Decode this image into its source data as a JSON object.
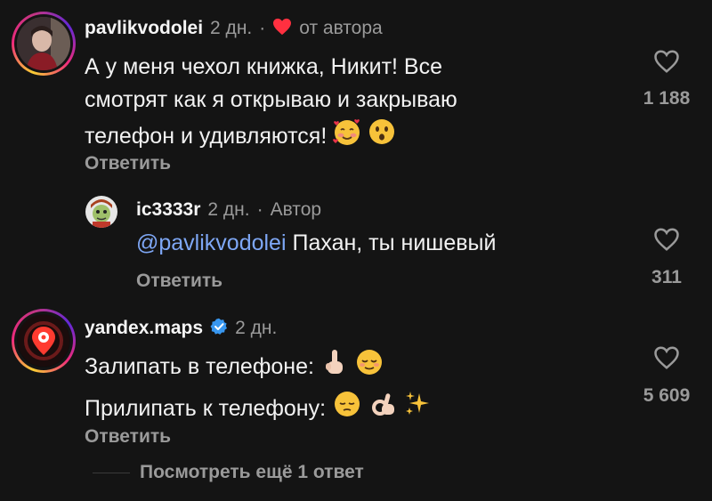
{
  "comments": [
    {
      "username": "pavlikvodolei",
      "time": "2 дн.",
      "separator": "·",
      "liked_by_author_label": "от автора",
      "text_lines": [
        "А у меня чехол книжка, Никит! Все",
        "смотрят как я открываю и закрываю",
        "телефон и удивляются!"
      ],
      "emojis": [
        "smiling-face-with-hearts-icon",
        "hushed-face-icon"
      ],
      "reply_label": "Ответить",
      "likes": "1 188",
      "reply": {
        "username": "ic3333r",
        "time": "2 дн.",
        "separator": "·",
        "author_label": "Автор",
        "mention": "@pavlikvodolei",
        "text": " Пахан, ты нишевый",
        "reply_label": "Ответить",
        "likes": "311"
      }
    },
    {
      "username": "yandex.maps",
      "verified": true,
      "time": "2 дн.",
      "line1": "Залипать в телефоне:",
      "line2": "Прилипать к телефону:",
      "emojis_line1": [
        "index-pointing-up-icon",
        "relieved-face-icon"
      ],
      "emojis_line2": [
        "pensive-face-icon",
        "ok-hand-icon",
        "sparkles-icon"
      ],
      "reply_label": "Ответить",
      "likes": "5 609",
      "view_more": "Посмотреть ещё 1 ответ"
    }
  ],
  "colors": {
    "background": "#141414",
    "text": "#f2f2f2",
    "muted": "#9a9a9a",
    "mention": "#7ea7f5",
    "heart_red": "#ff3040",
    "verified_blue": "#3897f0"
  }
}
